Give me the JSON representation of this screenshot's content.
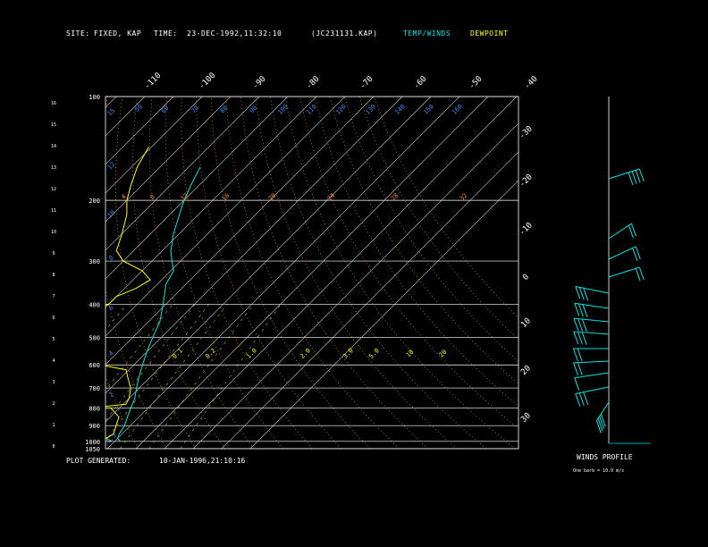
{
  "header": {
    "site_label": "SITE:",
    "site_value": "FIXED, KAP",
    "time_label": "TIME:",
    "time_value": "23-DEC-1992,11:32:10",
    "file_id": "(JC231131.KAP)",
    "temp_winds_legend": "TEMP/WINDS",
    "dewpoint_legend": "DEWPOINT"
  },
  "footer": {
    "plot_generated_label": "PLOT GENERATED:",
    "plot_generated_value": "10-JAN-1996,21:10:16"
  },
  "winds_panel": {
    "title": "WINDS PROFILE",
    "note": "One barb = 10.0 m/s"
  },
  "colors": {
    "temperature": "#00e5e5",
    "dewpoint": "#ffff00",
    "axes": "#ffffff",
    "isotherms": "#d8d8d8",
    "dry_adiabats": "#ff8c2a",
    "moist_adiabats": "#ff8c2a",
    "mixing_ratio": "#ffff00",
    "height_labels": "#3b8cff",
    "winds": "#00e5e5"
  },
  "chart_data": [
    {
      "type": "line",
      "subtype": "skew-T log-P diagram",
      "y_scale": "log",
      "pressure_ticks": [
        "100",
        "200",
        "300",
        "400",
        "500",
        "600",
        "700",
        "800",
        "900",
        "1000",
        "1050"
      ],
      "pressure_values": [
        100,
        200,
        300,
        400,
        500,
        600,
        700,
        800,
        900,
        1000,
        1050
      ],
      "height_ticks": [
        "0",
        "1",
        "2",
        "3",
        "4",
        "5",
        "6",
        "7",
        "8",
        "9",
        "10",
        "11",
        "12",
        "13",
        "14",
        "15",
        "16"
      ],
      "temperature_top_ticks": [
        "-110",
        "-100",
        "-90",
        "-80",
        "-70",
        "-60",
        "-50",
        "-40"
      ],
      "temperature_right_ticks": [
        "-30",
        "-20",
        "-10",
        "0",
        "10",
        "20",
        "30"
      ],
      "mixing_ratio_labels": [
        "0.1",
        "0.2",
        "1.0",
        "2.0",
        "3.0",
        "5.0",
        "10",
        "20"
      ],
      "top_isotherm_labels": [
        "-50",
        "60",
        "70",
        "80",
        "90",
        "100",
        "110",
        "120",
        "130",
        "140",
        "150",
        "160"
      ],
      "moist_adiabat_labels": [
        "4",
        "8",
        "12",
        "16",
        "20",
        "24",
        "28",
        "32"
      ],
      "height_marker_labels": [
        "16",
        "15",
        "12",
        "10",
        "8",
        "6",
        "4",
        "2",
        "0.5"
      ],
      "grid": true,
      "series": [
        {
          "name": "TEMP/WINDS",
          "points": [
            [
              1000,
              2
            ],
            [
              980,
              0
            ],
            [
              950,
              -1
            ],
            [
              900,
              -2
            ],
            [
              850,
              -4
            ],
            [
              800,
              -6
            ],
            [
              750,
              -8
            ],
            [
              700,
              -11
            ],
            [
              650,
              -14
            ],
            [
              600,
              -17
            ],
            [
              550,
              -20
            ],
            [
              500,
              -23
            ],
            [
              450,
              -26
            ],
            [
              400,
              -31
            ],
            [
              350,
              -37
            ],
            [
              320,
              -39
            ],
            [
              300,
              -43
            ],
            [
              280,
              -47
            ],
            [
              250,
              -52
            ],
            [
              230,
              -55
            ],
            [
              200,
              -60
            ],
            [
              180,
              -63
            ],
            [
              160,
              -66
            ]
          ]
        },
        {
          "name": "DEWPOINT",
          "points": [
            [
              1000,
              -1
            ],
            [
              980,
              -4
            ],
            [
              950,
              -3
            ],
            [
              900,
              -5
            ],
            [
              850,
              -7
            ],
            [
              800,
              -13
            ],
            [
              800,
              -20
            ],
            [
              780,
              -9
            ],
            [
              750,
              -10
            ],
            [
              700,
              -13
            ],
            [
              680,
              -15
            ],
            [
              650,
              -18
            ],
            [
              620,
              -21
            ],
            [
              600,
              -32
            ],
            [
              580,
              -40
            ],
            [
              570,
              -44
            ],
            [
              560,
              -52
            ],
            [
              560,
              -60
            ],
            [
              540,
              -58
            ],
            [
              500,
              -57
            ],
            [
              480,
              -58
            ],
            [
              460,
              -56
            ],
            [
              450,
              -60
            ],
            [
              430,
              -58
            ],
            [
              400,
              -50
            ],
            [
              380,
              -50
            ],
            [
              360,
              -46
            ],
            [
              340,
              -44
            ],
            [
              320,
              -50
            ],
            [
              300,
              -60
            ],
            [
              280,
              -66
            ],
            [
              250,
              -70
            ],
            [
              220,
              -75
            ],
            [
              200,
              -80
            ],
            [
              180,
              -84
            ],
            [
              160,
              -88
            ],
            [
              140,
              -91
            ]
          ]
        }
      ]
    },
    {
      "type": "other",
      "subtype": "wind barbs",
      "title": "WINDS PROFILE",
      "barb_unit_note": "One barb = 10.0 m/s",
      "barb_speed_ms": [
        40,
        20,
        20,
        20,
        30,
        30,
        30,
        30,
        20,
        20,
        10,
        30,
        40
      ]
    }
  ]
}
